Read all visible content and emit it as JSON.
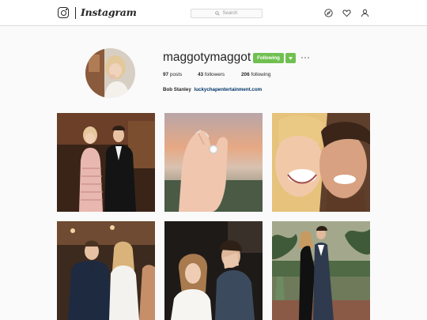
{
  "header": {
    "wordmark": "Instagram",
    "search_placeholder": "Search",
    "icons": [
      "instagram-logo-icon",
      "compass-icon",
      "heart-icon",
      "person-icon"
    ]
  },
  "profile": {
    "username": "maggotymaggot",
    "follow_label": "Following",
    "stats": [
      {
        "count": "97",
        "label": "posts"
      },
      {
        "count": "43",
        "label": "followers"
      },
      {
        "count": "206",
        "label": "following"
      }
    ],
    "full_name": "Bob Stanley",
    "website": "luckychapentertainment.com"
  },
  "colors": {
    "follow_green": "#70c050",
    "link_blue": "#003569",
    "border": "#dbdbdb",
    "background": "#fafafa"
  },
  "posts": [
    {
      "label": "post-couple-pink-dress"
    },
    {
      "label": "post-engagement-ring-hand"
    },
    {
      "label": "post-smiling-selfie"
    },
    {
      "label": "post-couple-white-blazer"
    },
    {
      "label": "post-couple-indoor-laughing"
    },
    {
      "label": "post-couple-garden-black-dress"
    }
  ]
}
